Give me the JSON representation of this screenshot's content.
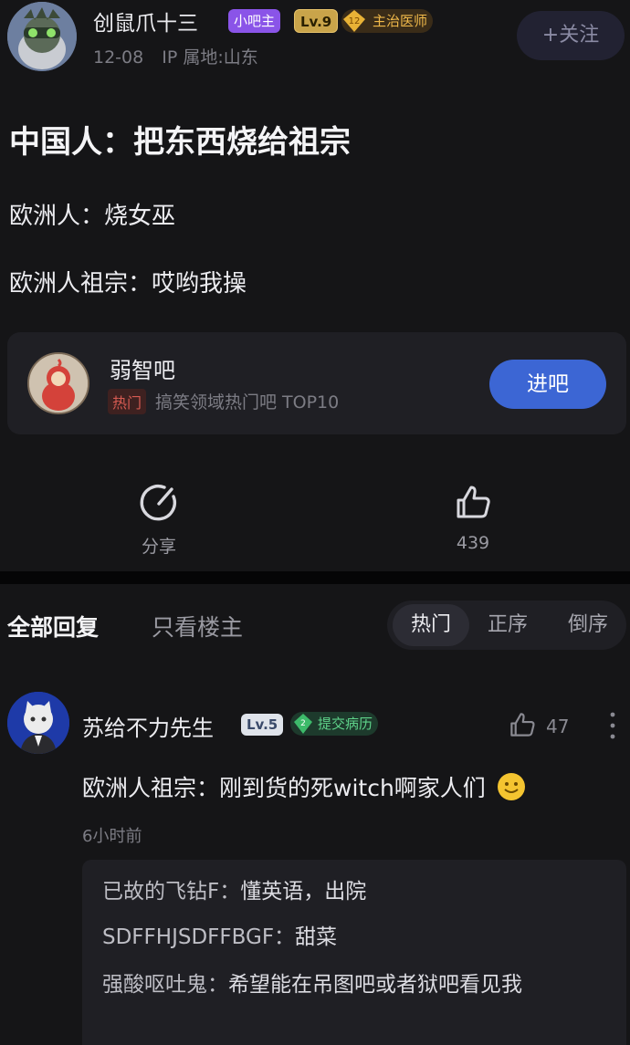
{
  "post": {
    "author": "创鼠爪十三",
    "badge_host": "小吧主",
    "badge_level": "Lv.9",
    "badge_title_num": "12",
    "badge_title": "主治医师",
    "date": "12-08",
    "ip": "IP 属地:山东",
    "follow_label": "+关注",
    "title": "中国人：把东西烧给祖宗",
    "line1": "欧洲人：烧女巫",
    "line2": "欧洲人祖宗：哎哟我操"
  },
  "forum": {
    "name": "弱智吧",
    "tag": "热门",
    "desc": "搞笑领域热门吧 TOP10",
    "enter_label": "进吧"
  },
  "actions": {
    "share_label": "分享",
    "like_count": "439"
  },
  "tabs": {
    "all": "全部回复",
    "op_only": "只看楼主",
    "sort_hot": "热门",
    "sort_asc": "正序",
    "sort_desc": "倒序"
  },
  "comment": {
    "author": "苏给不力先生",
    "level": "Lv.5",
    "title_num": "2",
    "title": "提交病历",
    "likes": "47",
    "body": "欧洲人祖宗：刚到货的死witch啊家人们",
    "time": "6小时前",
    "replies": [
      {
        "who": "已故的飞钻F：",
        "text": "懂英语，出院"
      },
      {
        "who": "SDFFHJSDFFBGF：",
        "text": "甜菜"
      },
      {
        "who": "强酸呕吐鬼：",
        "text": "希望能在吊图吧或者狱吧看见我"
      }
    ]
  },
  "colors": {
    "background": "#151517",
    "accent_blue": "#3c66d4",
    "host_purple": "#8a54e8",
    "hot_red": "#d65b52"
  }
}
